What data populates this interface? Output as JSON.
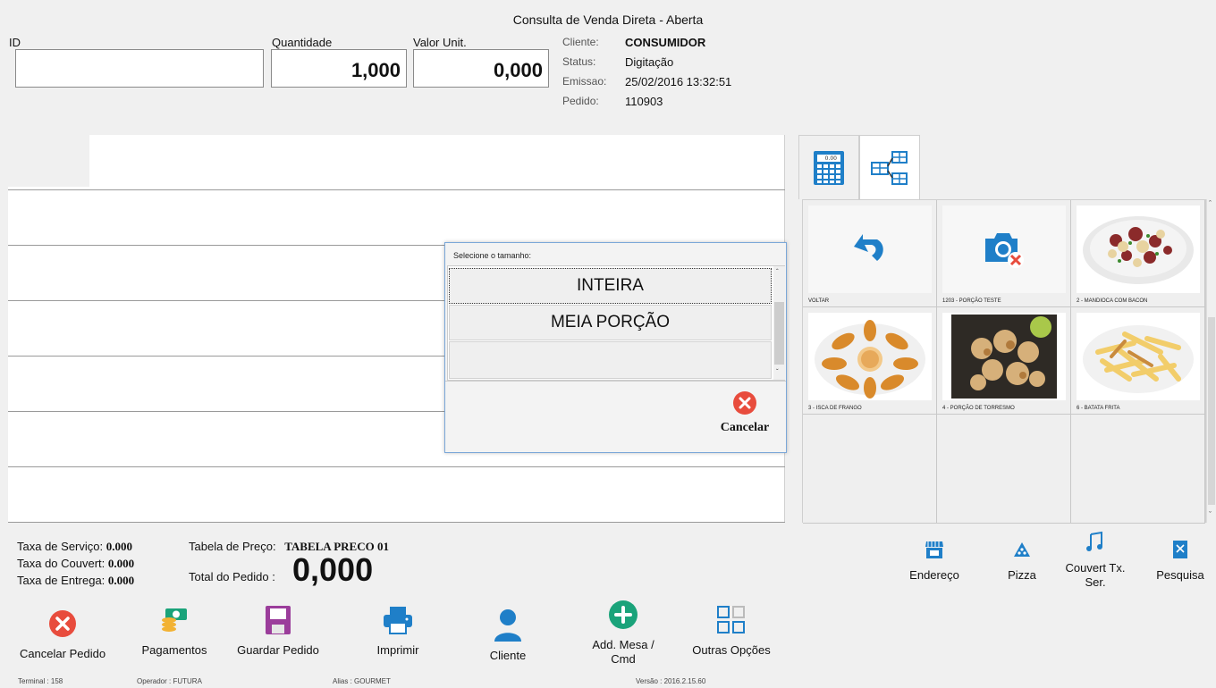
{
  "window": {
    "title": "Consulta de Venda Direta - Aberta"
  },
  "fields": {
    "id_label": "ID",
    "id_value": "",
    "qty_label": "Quantidade",
    "qty_value": "1,000",
    "unit_label": "Valor Unit.",
    "unit_value": "0,000"
  },
  "info": {
    "cliente_k": "Cliente:",
    "cliente_v": "CONSUMIDOR",
    "status_k": "Status:",
    "status_v": "Digitação",
    "emissao_k": "Emissao:",
    "emissao_v": "25/02/2016 13:32:51",
    "pedido_k": "Pedido:",
    "pedido_v": "110903"
  },
  "products": [
    {
      "name": "VOLTAR",
      "icon": "undo-icon"
    },
    {
      "name": "1203 - PORÇÃO TESTE",
      "icon": "camera-no-photo-icon"
    },
    {
      "name": "2 - MANDIOCA COM BACON",
      "icon": "food-photo"
    },
    {
      "name": "3 - ISCA DE FRANGO",
      "icon": "food-photo"
    },
    {
      "name": "4 - PORÇÃO DE TORRESMO",
      "icon": "food-photo"
    },
    {
      "name": "6 - BATATA FRITA",
      "icon": "food-photo"
    }
  ],
  "modal": {
    "title": "Selecione o tamanho:",
    "options": [
      "INTEIRA",
      "MEIA PORÇÃO",
      ""
    ],
    "cancel_label": "Cancelar"
  },
  "totals": {
    "servico_k": "Taxa de Serviço:",
    "servico_v": "0.000",
    "couvert_k": "Taxa do Couvert:",
    "couvert_v": "0.000",
    "entrega_k": "Taxa de Entrega:",
    "entrega_v": "0.000",
    "tabela_k": "Tabela de Preço:",
    "tabela_v": "TABELA PRECO 01",
    "total_k": "Total do Pedido :",
    "total_v": "0,000"
  },
  "right_actions": [
    "Endereço",
    "Pizza",
    "Couvert Tx. Ser.",
    "Pesquisa"
  ],
  "toolbar": [
    "Cancelar Pedido",
    "Pagamentos",
    "Guardar Pedido",
    "Imprimir",
    "Cliente",
    "Add. Mesa / Cmd",
    "Outras Opções"
  ],
  "status": {
    "terminal": "Terminal : 158",
    "operador": "Operador : FUTURA",
    "alias": "Alias : GOURMET",
    "versao": "Versão : 2016.2.15.60"
  },
  "colors": {
    "danger": "#e84c3d",
    "accent_blue": "#1f7fc8",
    "teal": "#1aa37a",
    "purple": "#9b3d9b"
  }
}
